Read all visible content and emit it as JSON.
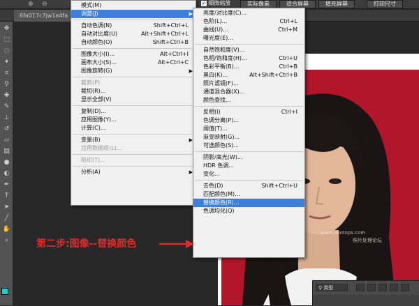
{
  "doc": {
    "tab_title": "6fa017c7jw1e4fa"
  },
  "optbar": {
    "btn_scrubby": "细微缩放",
    "btn_actual": "实际像素",
    "btn_fitscreen": "适合屏幕",
    "btn_fillscreen": "填充屏幕",
    "btn_print": "打印尺寸"
  },
  "image_menu": {
    "items": [
      {
        "label": "模式(M)",
        "shortcut": "",
        "disabled": false
      },
      {
        "label": "调整(J)",
        "shortcut": "",
        "submenu": true,
        "highlighted": true
      },
      {
        "label": "自动色调(N)",
        "shortcut": "Shift+Ctrl+L"
      },
      {
        "label": "自动对比度(U)",
        "shortcut": "Alt+Shift+Ctrl+L"
      },
      {
        "label": "自动颜色(O)",
        "shortcut": "Shift+Ctrl+B"
      },
      {
        "label": "图像大小(I)...",
        "shortcut": "Alt+Ctrl+I"
      },
      {
        "label": "画布大小(S)...",
        "shortcut": "Alt+Ctrl+C"
      },
      {
        "label": "图像旋转(G)",
        "shortcut": "",
        "submenu": true
      },
      {
        "label": "裁剪(P)",
        "shortcut": "",
        "disabled": true
      },
      {
        "label": "裁切(R)...",
        "shortcut": ""
      },
      {
        "label": "显示全部(V)",
        "shortcut": ""
      },
      {
        "label": "复制(D)...",
        "shortcut": ""
      },
      {
        "label": "应用图像(Y)...",
        "shortcut": ""
      },
      {
        "label": "计算(C)...",
        "shortcut": ""
      },
      {
        "label": "变量(B)",
        "shortcut": "",
        "submenu": true
      },
      {
        "label": "应用数据组(L)...",
        "shortcut": "",
        "disabled": true
      },
      {
        "label": "陷印(T)...",
        "shortcut": "",
        "disabled": true
      },
      {
        "label": "分析(A)",
        "shortcut": "",
        "submenu": true
      }
    ]
  },
  "adjust_menu": {
    "items": [
      {
        "label": "亮度/对比度(C)...",
        "shortcut": ""
      },
      {
        "label": "色阶(L)...",
        "shortcut": "Ctrl+L"
      },
      {
        "label": "曲线(U)...",
        "shortcut": "Ctrl+M"
      },
      {
        "label": "曝光度(E)...",
        "shortcut": ""
      },
      {
        "label": "自然饱和度(V)...",
        "shortcut": ""
      },
      {
        "label": "色相/饱和度(H)...",
        "shortcut": "Ctrl+U"
      },
      {
        "label": "色彩平衡(B)...",
        "shortcut": "Ctrl+B"
      },
      {
        "label": "黑白(K)...",
        "shortcut": "Alt+Shift+Ctrl+B"
      },
      {
        "label": "照片滤镜(F)...",
        "shortcut": ""
      },
      {
        "label": "通道混合器(X)...",
        "shortcut": ""
      },
      {
        "label": "颜色查找...",
        "shortcut": ""
      },
      {
        "label": "反相(I)",
        "shortcut": "Ctrl+I"
      },
      {
        "label": "色调分离(P)...",
        "shortcut": ""
      },
      {
        "label": "阈值(T)...",
        "shortcut": ""
      },
      {
        "label": "渐变映射(G)...",
        "shortcut": ""
      },
      {
        "label": "可选颜色(S)...",
        "shortcut": ""
      },
      {
        "label": "阴影/高光(W)...",
        "shortcut": ""
      },
      {
        "label": "HDR 色调...",
        "shortcut": ""
      },
      {
        "label": "变化...",
        "shortcut": ""
      },
      {
        "label": "去色(D)",
        "shortcut": "Shift+Ctrl+U"
      },
      {
        "label": "匹配颜色(M)...",
        "shortcut": ""
      },
      {
        "label": "替换颜色(R)...",
        "shortcut": "",
        "highlighted": true
      },
      {
        "label": "色调均化(Q)",
        "shortcut": ""
      }
    ]
  },
  "annotation": {
    "text": "第二步:图像--替换颜色"
  },
  "watermark": {
    "line1": "www.photops.com",
    "line2": "照片处理论坛"
  },
  "layers": {
    "filter_label": "类型"
  },
  "colors": {
    "accent": "#3d7fd9",
    "annotation": "#e02a2a",
    "photo_bg": "#b3162a"
  }
}
